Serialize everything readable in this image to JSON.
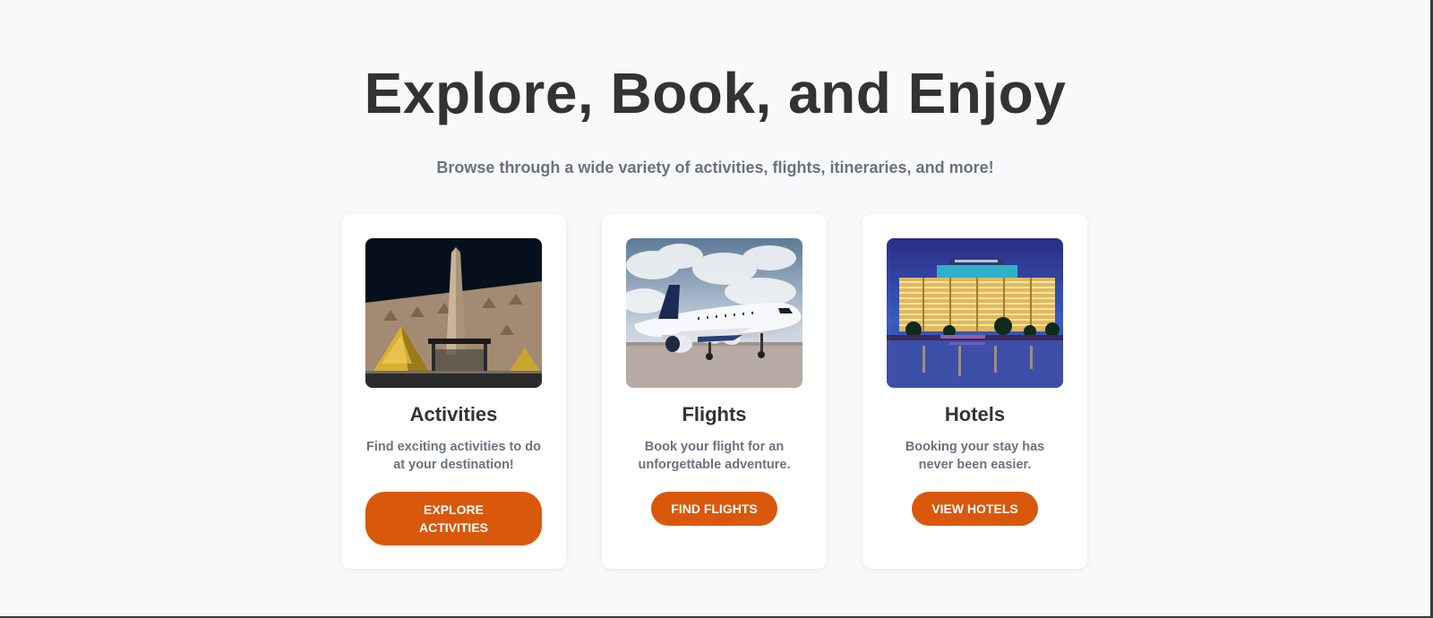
{
  "hero": {
    "title": "Explore, Book, and Enjoy",
    "subtitle": "Browse through a wide variety of activities, flights, itineraries, and more!"
  },
  "cards": [
    {
      "image": "pyramid-museum-night-photo",
      "title": "Activities",
      "description": "Find exciting activities to do at your destination!",
      "button_label": "EXPLORE ACTIVITIES"
    },
    {
      "image": "airplane-on-tarmac-photo",
      "title": "Flights",
      "description": "Book your flight for an unforgettable adventure.",
      "button_label": "FIND FLIGHTS"
    },
    {
      "image": "riverside-hotel-night-photo",
      "title": "Hotels",
      "description": "Booking your stay has never been easier.",
      "button_label": "VIEW HOTELS"
    }
  ],
  "colors": {
    "background": "#f8f9fb",
    "accent": "#d9580b",
    "heading": "#333333",
    "muted": "#6b7280"
  }
}
